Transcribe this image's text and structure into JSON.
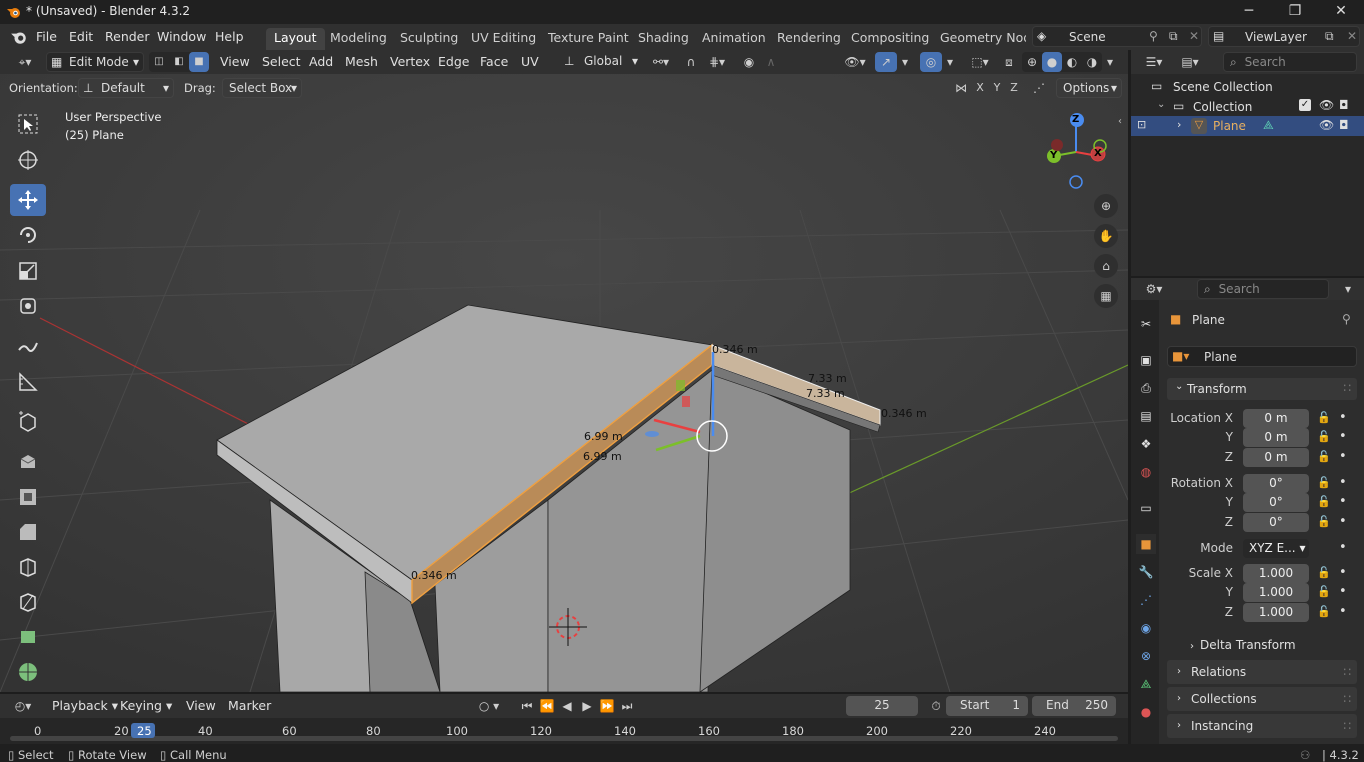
{
  "window": {
    "title": "* (Unsaved) - Blender 4.3.2",
    "minimize": "─",
    "maximize": "❐",
    "close": "✕"
  },
  "menu": {
    "items": [
      "File",
      "Edit",
      "Render",
      "Window",
      "Help"
    ],
    "workspaces": [
      "Layout",
      "Modeling",
      "Sculpting",
      "UV Editing",
      "Texture Paint",
      "Shading",
      "Animation",
      "Rendering",
      "Compositing",
      "Geometry Node"
    ],
    "active_workspace": "Layout",
    "scene": "Scene",
    "view_layer": "ViewLayer"
  },
  "viewport_header": {
    "mode": "Edit Mode",
    "menus": [
      "View",
      "Select",
      "Add",
      "Mesh",
      "Vertex",
      "Edge",
      "Face",
      "UV"
    ],
    "transform_orientation": "Global",
    "orientation_label": "Orientation:",
    "orientation_value": "Default",
    "drag_label": "Drag:",
    "drag_value": "Select Box",
    "axes": [
      "X",
      "Y",
      "Z"
    ],
    "options": "Options"
  },
  "viewport": {
    "perspective": "User Perspective",
    "object_info": "(25) Plane",
    "measurements": [
      "0.346 m",
      "7.33 m",
      "7.33 m",
      "0.346 m",
      "6.99 m",
      "6.99 m",
      "0.346 m"
    ],
    "gizmo_axes": [
      "Z",
      "Y",
      "X"
    ]
  },
  "outliner": {
    "search_placeholder": "Search",
    "scene_collection": "Scene Collection",
    "collection": "Collection",
    "object": "Plane"
  },
  "properties": {
    "search_placeholder": "Search",
    "object_name": "Plane",
    "data_name": "Plane",
    "transform_title": "Transform",
    "location": {
      "label": "Location X",
      "x": "0 m",
      "y": "0 m",
      "z": "0 m"
    },
    "rotation": {
      "label": "Rotation X",
      "x": "0°",
      "y": "0°",
      "z": "0°"
    },
    "mode_label": "Mode",
    "mode_value": "XYZ E...",
    "scale": {
      "label": "Scale X",
      "x": "1.000",
      "y": "1.000",
      "z": "1.000"
    },
    "y_label": "Y",
    "z_label": "Z",
    "sections": [
      "Delta Transform",
      "Relations",
      "Collections",
      "Instancing"
    ]
  },
  "timeline": {
    "menus": [
      "Playback",
      "Keying",
      "View",
      "Marker"
    ],
    "current_frame": "25",
    "start_label": "Start",
    "start": "1",
    "end_label": "End",
    "end": "250",
    "ticks": [
      "0",
      "20",
      "40",
      "60",
      "80",
      "100",
      "120",
      "140",
      "160",
      "180",
      "200",
      "220",
      "240"
    ]
  },
  "status_bar": {
    "items": [
      "Select",
      "Rotate View",
      "Call Menu"
    ],
    "version": "4.3.2"
  }
}
